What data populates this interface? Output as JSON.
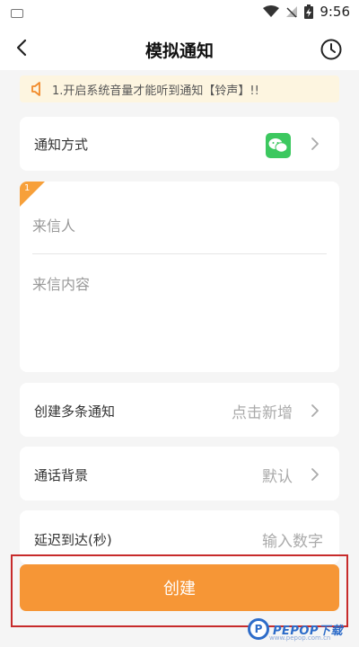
{
  "status_bar": {
    "time": "9:56"
  },
  "nav": {
    "title": "模拟通知"
  },
  "notice": {
    "text": "1.开启系统音量才能听到通知【铃声】!!"
  },
  "notify_method": {
    "label": "通知方式"
  },
  "message": {
    "badge": "1",
    "sender_placeholder": "来信人",
    "content_placeholder": "来信内容"
  },
  "multi_notify": {
    "label": "创建多条通知",
    "value": "点击新增"
  },
  "call_background": {
    "label": "通话背景",
    "value": "默认"
  },
  "delay": {
    "label": "延迟到达(秒)",
    "placeholder": "输入数字"
  },
  "create_button": {
    "label": "创建"
  },
  "watermark": {
    "logo": "P",
    "text": "PEPOP下载",
    "url": "www.pepop.com.cn"
  },
  "colors": {
    "accent": "#f69636",
    "wechat": "#3cc85f",
    "notice_bg": "#fdf5e0",
    "highlight": "#c72b2b"
  }
}
